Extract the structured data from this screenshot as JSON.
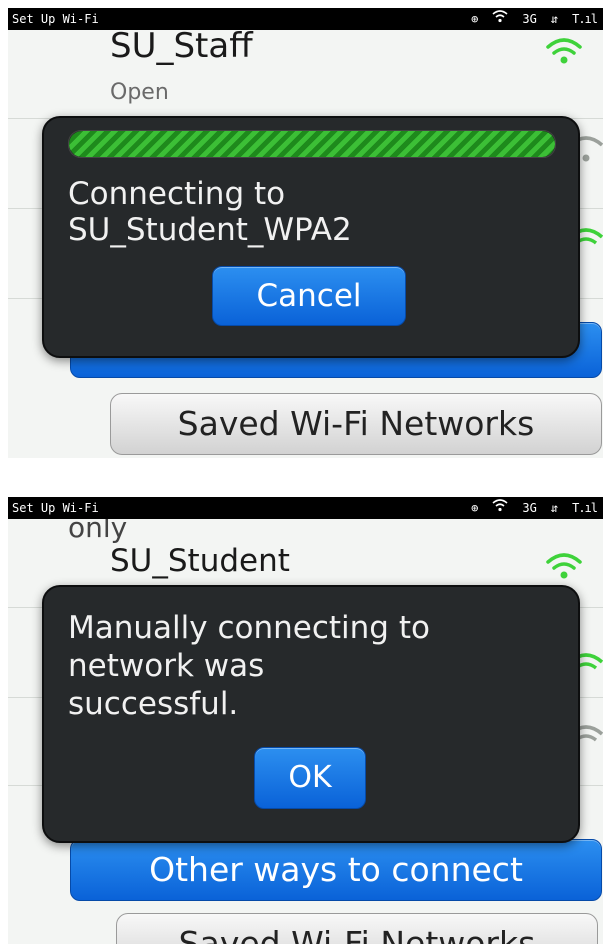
{
  "screen1": {
    "statusbar": {
      "title": "Set Up Wi-Fi",
      "network": "3G"
    },
    "networks": [
      {
        "ssid": "SU_Staff",
        "security": "Open"
      }
    ],
    "dialog": {
      "progress_fraction": 1.0,
      "message": "Connecting to\nSU_Student_WPA2",
      "cancel_label": "Cancel"
    },
    "saved_button_label": "Saved Wi-Fi Networks"
  },
  "screen2": {
    "statusbar": {
      "title": "Set Up Wi-Fi",
      "network": "3G"
    },
    "partial_text": "only",
    "networks": [
      {
        "ssid": "SU_Student"
      }
    ],
    "dialog": {
      "message": "Manually connecting to\nnetwork was\nsuccessful.",
      "ok_label": "OK"
    },
    "other_ways_label": "Other ways to connect",
    "saved_button_label": "Saved Wi-Fi Networks"
  },
  "colors": {
    "accent_blue": "#0a62d8",
    "wifi_green": "#3ed23a",
    "dialog_bg": "#26292b"
  },
  "icons": [
    "wifi-signal-icon",
    "bluetooth-icon",
    "wifi-status-icon",
    "network-activity-icon",
    "cell-signal-icon"
  ]
}
